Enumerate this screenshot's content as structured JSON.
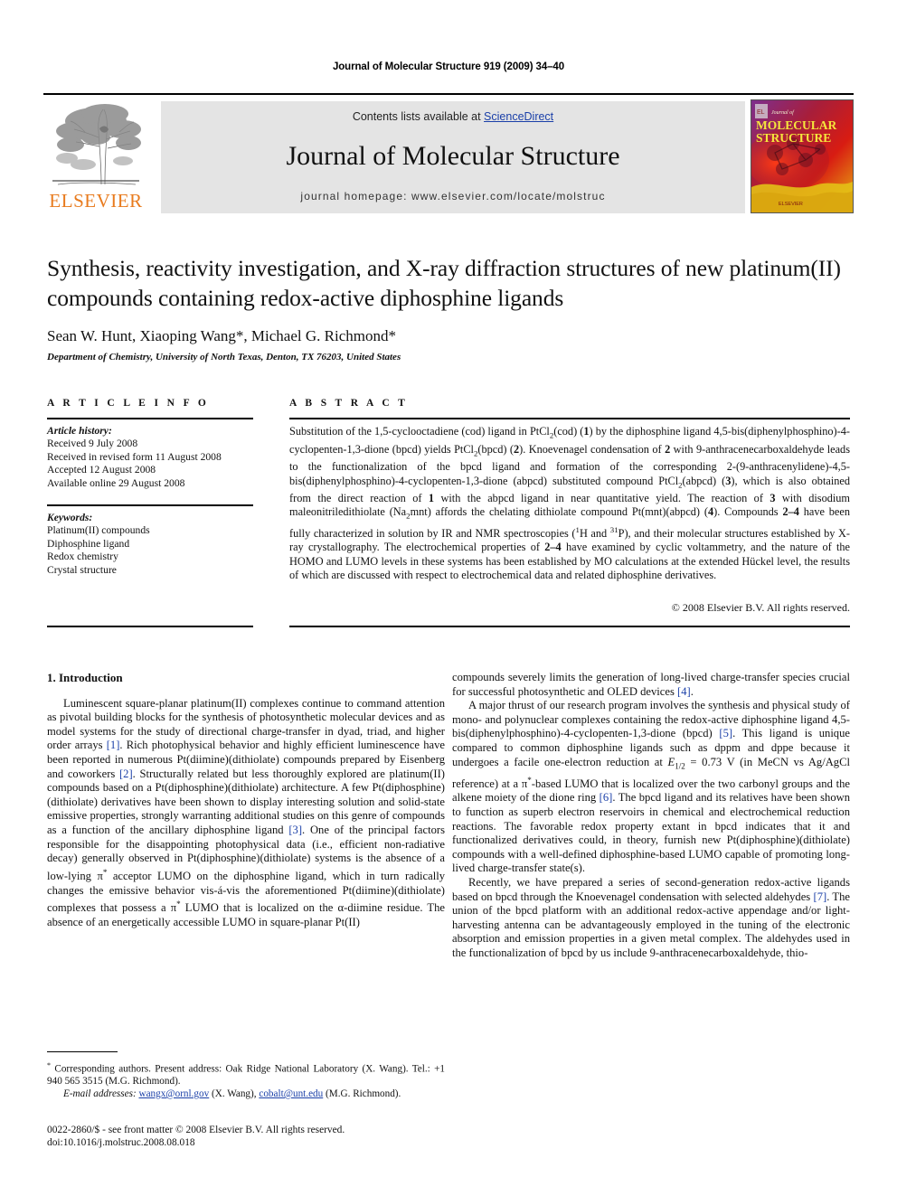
{
  "running_head": "Journal of Molecular Structure 919 (2009) 34–40",
  "masthead": {
    "contents_prefix": "Contents lists available at ",
    "sciencedirect": "ScienceDirect",
    "journal_name": "Journal of Molecular Structure",
    "homepage": "journal homepage: www.elsevier.com/locate/molstruc",
    "publisher_wordmark": "ELSEVIER",
    "publisher_color": "#E87B1E",
    "link_color": "#1a3fa8",
    "panel_color": "#e4e4e4",
    "cover_title_line1": "MOLECULAR",
    "cover_title_line2": "STRUCTURE",
    "cover_kicker": "Journal of",
    "cover_footer": "ELSEVIER"
  },
  "title": "Synthesis, reactivity investigation, and X-ray diffraction structures of new platinum(II) compounds containing redox-active diphosphine ligands",
  "authors": "Sean W. Hunt, Xiaoping Wang*, Michael G. Richmond*",
  "affiliation": "Department of Chemistry, University of North Texas, Denton, TX 76203, United States",
  "article_info": {
    "heading": "A R T I C L E   I N F O",
    "history_label": "Article history:",
    "history": [
      "Received 9 July 2008",
      "Received in revised form 11 August 2008",
      "Accepted 12 August 2008",
      "Available online 29 August 2008"
    ],
    "keywords_label": "Keywords:",
    "keywords": [
      "Platinum(II) compounds",
      "Diphosphine ligand",
      "Redox chemistry",
      "Crystal structure"
    ]
  },
  "abstract": {
    "heading": "A B S T R A C T",
    "text_html": "Substitution of the 1,5-cyclooctadiene (cod) ligand in PtCl<sub>2</sub>(cod) (<b>1</b>) by the diphosphine ligand 4,5-bis(diphenylphosphino)-4-cyclopenten-1,3-dione (bpcd) yields PtCl<sub>2</sub>(bpcd) (<b>2</b>). Knoevenagel condensation of <b>2</b> with 9-anthracenecarboxaldehyde leads to the functionalization of the bpcd ligand and formation of the corresponding 2-(9-anthracenylidene)-4,5-bis(diphenylphosphino)-4-cyclopenten-1,3-dione (abpcd) substituted compound PtCl<sub>2</sub>(abpcd) (<b>3</b>), which is also obtained from the direct reaction of <b>1</b> with the abpcd ligand in near quantitative yield. The reaction of <b>3</b> with disodium maleonitriledithiolate (Na<sub>2</sub>mnt) affords the chelating dithiolate compound Pt(mnt)(abpcd) (<b>4</b>). Compounds <b>2–4</b> have been fully characterized in solution by IR and NMR spectroscopies (<sup>1</sup>H and <sup>31</sup>P), and their molecular structures established by X-ray crystallography. The electrochemical properties of <b>2–4</b> have examined by cyclic voltammetry, and the nature of the HOMO and LUMO levels in these systems has been established by MO calculations at the extended Hückel level, the results of which are discussed with respect to electrochemical data and related diphosphine derivatives.",
    "copyright": "© 2008 Elsevier B.V. All rights reserved."
  },
  "body": {
    "section_title": "1. Introduction",
    "left_paragraphs_html": [
      "Luminescent square-planar platinum(II) complexes continue to command attention as pivotal building blocks for the synthesis of photosynthetic molecular devices and as model systems for the study of directional charge-transfer in dyad, triad, and higher order arrays <span class=\"ref\">[1]</span>. Rich photophysical behavior and highly efficient luminescence have been reported in numerous Pt(diimine)(dithiolate) compounds prepared by Eisenberg and coworkers <span class=\"ref\">[2]</span>. Structurally related but less thoroughly explored are platinum(II) compounds based on a Pt(diphosphine)(dithiolate) architecture. A few Pt(diphosphine)(dithiolate) derivatives have been shown to display interesting solution and solid-state emissive properties, strongly warranting additional studies on this genre of compounds as a function of the ancillary diphosphine ligand <span class=\"ref\">[3]</span>. One of the principal factors responsible for the disappointing photophysical data (i.e., efficient non-radiative decay) generally observed in Pt(diphosphine)(dithiolate) systems is the absence of a low-lying π<sup>*</sup> acceptor LUMO on the diphosphine ligand, which in turn radically changes the emissive behavior vis-á-vis the aforementioned Pt(diimine)(dithiolate) complexes that possess a π<sup>*</sup> LUMO that is localized on the α-diimine residue. The absence of an energetically accessible LUMO in square-planar Pt(II)"
    ],
    "right_paragraphs_html": [
      "compounds severely limits the generation of long-lived charge-transfer species crucial for successful photosynthetic and OLED devices <span class=\"ref\">[4]</span>.",
      "A major thrust of our research program involves the synthesis and physical study of mono- and polynuclear complexes containing the redox-active diphosphine ligand 4,5-bis(diphenylphosphino)-4-cyclopenten-1,3-dione (bpcd) <span class=\"ref\">[5]</span>. This ligand is unique compared to common diphosphine ligands such as dppm and dppe because it undergoes a facile one-electron reduction at <span class=\"ital\">E</span><sub>1/2</sub> = 0.73 V (in MeCN vs Ag/AgCl reference) at a π<sup>*</sup>-based LUMO that is localized over the two carbonyl groups and the alkene moiety of the dione ring <span class=\"ref\">[6]</span>. The bpcd ligand and its relatives have been shown to function as superb electron reservoirs in chemical and electrochemical reduction reactions. The favorable redox property extant in bpcd indicates that it and functionalized derivatives could, in theory, furnish new Pt(diphosphine)(dithiolate) compounds with a well-defined diphosphine-based LUMO capable of promoting long-lived charge-transfer state(s).",
      "Recently, we have prepared a series of second-generation redox-active ligands based on bpcd through the Knoevenagel condensation with selected aldehydes <span class=\"ref\">[7]</span>. The union of the bpcd platform with an additional redox-active appendage and/or light-harvesting antenna can be advantageously employed in the tuning of the electronic absorption and emission properties in a given metal complex. The aldehydes used in the functionalization of bpcd by us include 9-anthracenecarboxaldehyde, thio-"
    ]
  },
  "footnotes": {
    "corresponding_html": "<sup>*</sup> Corresponding authors. Present address: Oak Ridge National Laboratory (X. Wang). Tel.: +1 940 565 3515 (M.G. Richmond).",
    "email_label": "E-mail addresses:",
    "email_1": "wangx@ornl.gov",
    "email_1_owner": "(X. Wang),",
    "email_2": "cobalt@unt.edu",
    "email_2_owner": "(M.G. Richmond)."
  },
  "imprint": {
    "line1": "0022-2860/$ - see front matter © 2008 Elsevier B.V. All rights reserved.",
    "line2": "doi:10.1016/j.molstruc.2008.08.018"
  }
}
